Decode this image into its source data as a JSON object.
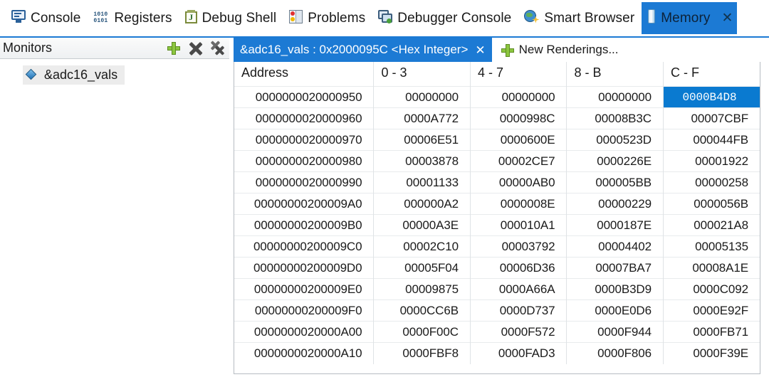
{
  "view_tabs": [
    {
      "label": "Console",
      "icon": "console-icon",
      "active": false,
      "closable": false
    },
    {
      "label": "Registers",
      "icon": "registers-icon",
      "active": false,
      "closable": false
    },
    {
      "label": "Debug Shell",
      "icon": "debug-shell-icon",
      "active": false,
      "closable": false
    },
    {
      "label": "Problems",
      "icon": "problems-icon",
      "active": false,
      "closable": false
    },
    {
      "label": "Debugger Console",
      "icon": "debugger-console-icon",
      "active": false,
      "closable": false
    },
    {
      "label": "Smart Browser",
      "icon": "smart-browser-icon",
      "active": false,
      "closable": false
    },
    {
      "label": "Memory",
      "icon": "memory-icon",
      "active": true,
      "closable": true
    }
  ],
  "monitors": {
    "title": "Monitors",
    "toolbar": {
      "add_label": "Add Memory Monitor",
      "remove_label": "Remove Memory Monitor",
      "remove_all_label": "Remove All Memory Monitors"
    },
    "items": [
      {
        "label": "&adc16_vals",
        "icon": "monitor-diamond-icon",
        "selected": true
      }
    ]
  },
  "rendering": {
    "tab_label": "&adc16_vals : 0x2000095C <Hex Integer>",
    "tab_close": "✕",
    "new_renderings_label": "New Renderings..."
  },
  "colors": {
    "accent_blue": "#1c7ad4",
    "selection_blue": "#0a7ad0",
    "add_green": "#8cc63f",
    "grid_line": "#e8ebed"
  },
  "memory_table": {
    "headers": [
      "Address",
      "0 - 3",
      "4 - 7",
      "8 - B",
      "C - F"
    ],
    "selected_cell": {
      "row": 0,
      "col": 4
    },
    "rows": [
      {
        "address": "0000000020000950",
        "cells": [
          "00000000",
          "00000000",
          "00000000",
          "0000B4D8"
        ]
      },
      {
        "address": "0000000020000960",
        "cells": [
          "0000A772",
          "0000998C",
          "00008B3C",
          "00007CBF"
        ]
      },
      {
        "address": "0000000020000970",
        "cells": [
          "00006E51",
          "0000600E",
          "0000523D",
          "000044FB"
        ]
      },
      {
        "address": "0000000020000980",
        "cells": [
          "00003878",
          "00002CE7",
          "0000226E",
          "00001922"
        ]
      },
      {
        "address": "0000000020000990",
        "cells": [
          "00001133",
          "00000AB0",
          "000005BB",
          "00000258"
        ]
      },
      {
        "address": "00000000200009A0",
        "cells": [
          "000000A2",
          "0000008E",
          "00000229",
          "0000056B"
        ]
      },
      {
        "address": "00000000200009B0",
        "cells": [
          "00000A3E",
          "000010A1",
          "0000187E",
          "000021A8"
        ]
      },
      {
        "address": "00000000200009C0",
        "cells": [
          "00002C10",
          "00003792",
          "00004402",
          "00005135"
        ]
      },
      {
        "address": "00000000200009D0",
        "cells": [
          "00005F04",
          "00006D36",
          "00007BA7",
          "00008A1E"
        ]
      },
      {
        "address": "00000000200009E0",
        "cells": [
          "00009875",
          "0000A66A",
          "0000B3D9",
          "0000C092"
        ]
      },
      {
        "address": "00000000200009F0",
        "cells": [
          "0000CC6B",
          "0000D737",
          "0000E0D6",
          "0000E92F"
        ]
      },
      {
        "address": "0000000020000A00",
        "cells": [
          "0000F00C",
          "0000F572",
          "0000F944",
          "0000FB71"
        ]
      },
      {
        "address": "0000000020000A10",
        "cells": [
          "0000FBF8",
          "0000FAD3",
          "0000F806",
          "0000F39E"
        ]
      }
    ]
  }
}
